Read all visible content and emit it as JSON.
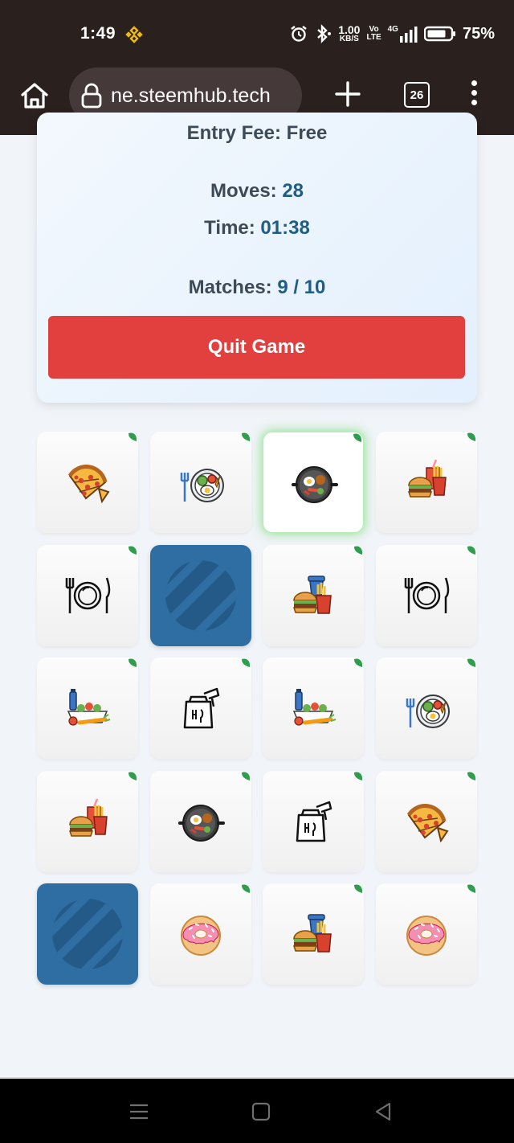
{
  "status_bar": {
    "time": "1:49",
    "net_speed_top": "1.00",
    "net_speed_bottom": "KB/S",
    "volte_top": "Vo",
    "volte_bottom": "LTE",
    "network": "4G",
    "battery": "75%"
  },
  "browser": {
    "url": "ne.steemhub.tech",
    "tab_count": "26"
  },
  "game": {
    "entry_fee_label": "Entry Fee:",
    "entry_fee_value": "Free",
    "moves_label": "Moves:",
    "moves_value": "28",
    "time_label": "Time:",
    "time_value": "01:38",
    "matches_label": "Matches:",
    "matches_value": "9 / 10",
    "quit_label": "Quit Game"
  },
  "board": {
    "cards": [
      {
        "icon": "pizza-icon"
      },
      {
        "icon": "salad-plate-icon"
      },
      {
        "icon": "pan-breakfast-icon",
        "selected": true
      },
      {
        "icon": "burger-fries-drink-icon"
      },
      {
        "icon": "plate-fork-knife-icon"
      },
      {
        "icon": "card-back",
        "face_down": true
      },
      {
        "icon": "burger-fries-cup-icon"
      },
      {
        "icon": "plate-fork-knife-icon"
      },
      {
        "icon": "groceries-icon"
      },
      {
        "icon": "takeaway-bag-icon"
      },
      {
        "icon": "groceries-icon"
      },
      {
        "icon": "salad-plate-icon"
      },
      {
        "icon": "burger-fries-drink-icon"
      },
      {
        "icon": "pan-breakfast-icon"
      },
      {
        "icon": "takeaway-bag-icon"
      },
      {
        "icon": "pizza-icon"
      },
      {
        "icon": "card-back",
        "face_down": true
      },
      {
        "icon": "donut-icon"
      },
      {
        "icon": "burger-fries-cup-icon"
      },
      {
        "icon": "donut-icon"
      }
    ]
  },
  "colors": {
    "status_bg": "#2a201e",
    "quit_red": "#e23f3f",
    "value_blue": "#1f5d85",
    "card_back_blue": "#2f6ea3",
    "match_green": "#2e9e4e"
  }
}
